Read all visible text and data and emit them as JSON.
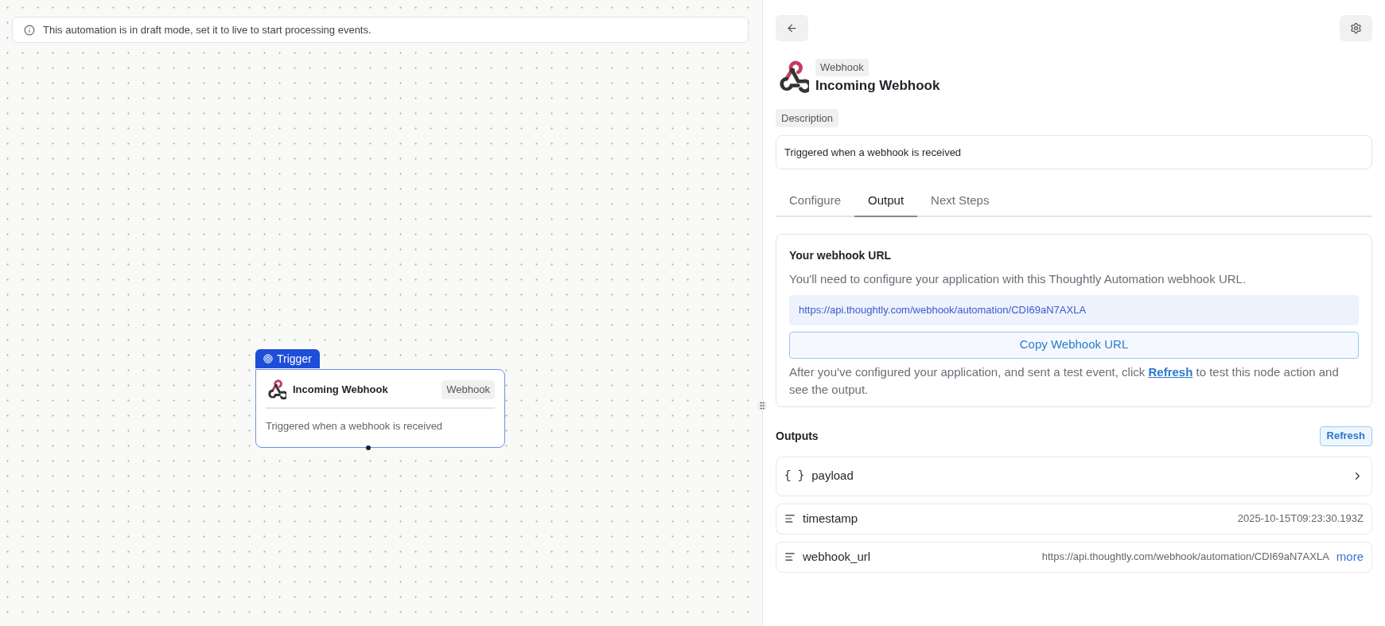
{
  "banner": {
    "text": "This automation is in draft mode, set it to live to start processing events."
  },
  "node": {
    "tab": "Trigger",
    "title": "Incoming Webhook",
    "badge": "Webhook",
    "description": "Triggered when a webhook is received",
    "selected": true
  },
  "panel": {
    "badge": "Webhook",
    "title": "Incoming Webhook",
    "description_label": "Description",
    "description": "Triggered when a webhook is received",
    "tabs": [
      {
        "label": "Configure",
        "selected": false
      },
      {
        "label": "Output",
        "selected": true
      },
      {
        "label": "Next Steps",
        "selected": false
      }
    ],
    "webhook_card": {
      "title": "Your webhook URL",
      "intro": "You'll need to configure your application with this Thoughtly Automation webhook URL.",
      "url": "https://api.thoughtly.com/webhook/automation/CDI69aN7AXLA",
      "copy_button": "Copy Webhook URL",
      "note_before": "After you've configured your application, and sent a test event, click",
      "note_link": "Refresh",
      "note_after": "to test this node action and see the output."
    },
    "outputs": {
      "title": "Outputs",
      "refresh_button": "Refresh",
      "rows": [
        {
          "kind": "object",
          "icon": "{ }",
          "name": "payload"
        },
        {
          "kind": "text",
          "name": "timestamp",
          "value": "2025-10-15T09:23:30.193Z"
        },
        {
          "kind": "text",
          "name": "webhook_url",
          "value": "https://api.thoughtly.com/webhook/automation/CDI69aN7AXLA",
          "more": "more"
        }
      ]
    }
  }
}
